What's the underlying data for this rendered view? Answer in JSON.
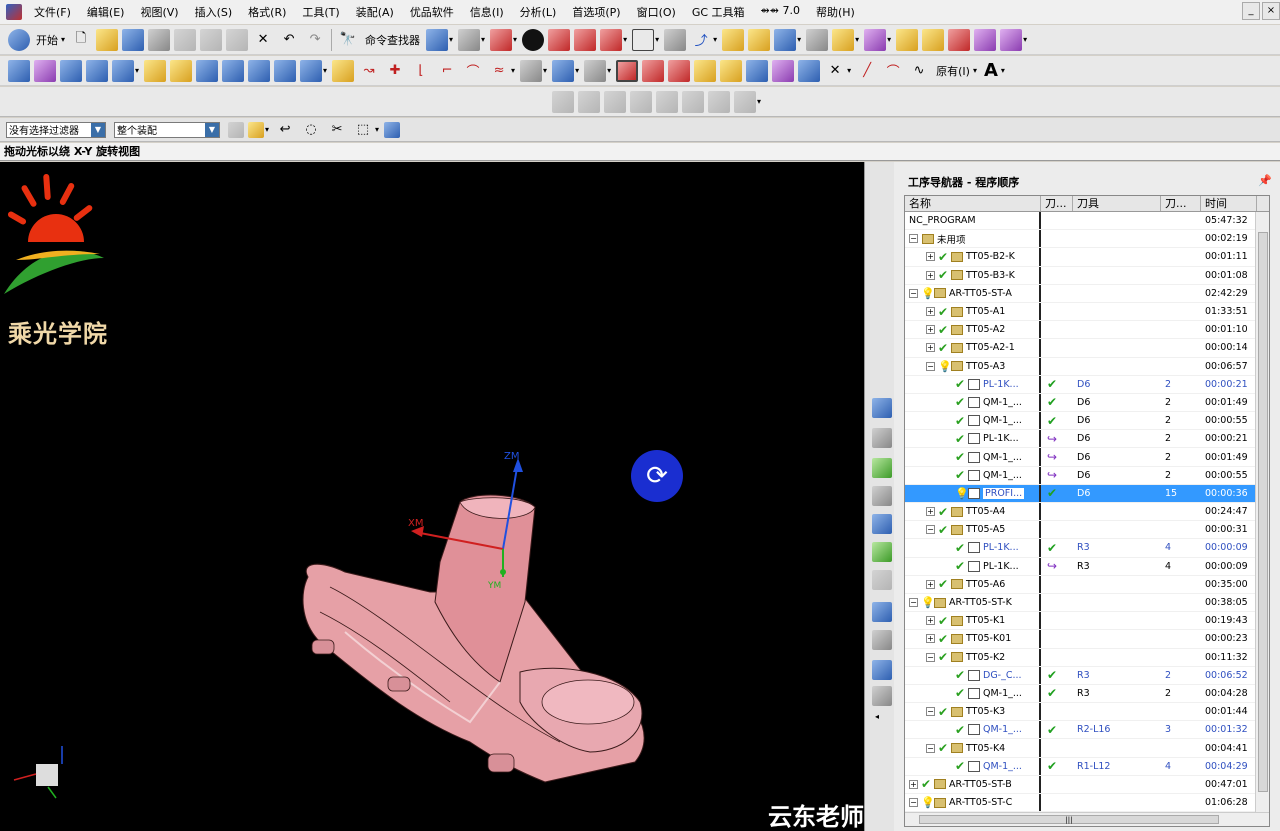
{
  "menubar": {
    "items": [
      "文件(F)",
      "编辑(E)",
      "视图(V)",
      "插入(S)",
      "格式(R)",
      "工具(T)",
      "装配(A)",
      "优品软件",
      "信息(I)",
      "分析(L)",
      "首选项(P)",
      "窗口(O)",
      "GC 工具箱",
      "⇴⇴ 7.0",
      "帮助(H)"
    ]
  },
  "toolbar": {
    "start_label": "开始",
    "command_finder_label": "命令查找器",
    "original_label": "原有(I)",
    "text_tool": "A"
  },
  "filterbar": {
    "selection_filter": "没有选择过滤器",
    "assembly_scope": "整个装配"
  },
  "status": {
    "prompt": "拖动光标以绕 X-Y 旋转视图"
  },
  "viewport": {
    "logo_text": "乘光学院",
    "watermark": "云东老师",
    "axis_labels": {
      "zm": "ZM",
      "xm": "XM",
      "ym": "YM"
    }
  },
  "navigator": {
    "title": "工序导航器 - 程序顺序",
    "columns": [
      "名称",
      "刀...",
      "刀具",
      "刀...",
      "时间"
    ],
    "rows": [
      {
        "name": "NC_PROGRAM",
        "level": 0,
        "exp": "",
        "icon": "none",
        "mark": "",
        "c2": "",
        "tool": "",
        "num": "",
        "time": "05:47:32"
      },
      {
        "name": "未用项",
        "level": 0,
        "exp": "-",
        "icon": "folder",
        "mark": "",
        "c2": "",
        "tool": "",
        "num": "",
        "time": "00:02:19"
      },
      {
        "name": "TT05-B2-K",
        "level": 1,
        "exp": "+",
        "icon": "folder",
        "mark": "check",
        "c2": "",
        "tool": "",
        "num": "",
        "time": "00:01:11"
      },
      {
        "name": "TT05-B3-K",
        "level": 1,
        "exp": "+",
        "icon": "folder",
        "mark": "check",
        "c2": "",
        "tool": "",
        "num": "",
        "time": "00:01:08"
      },
      {
        "name": "AR-TT05-ST-A",
        "level": 0,
        "exp": "-",
        "icon": "folder",
        "mark": "bulb",
        "c2": "",
        "tool": "",
        "num": "",
        "time": "02:42:29"
      },
      {
        "name": "TT05-A1",
        "level": 1,
        "exp": "+",
        "icon": "folder",
        "mark": "check",
        "c2": "",
        "tool": "",
        "num": "",
        "time": "01:33:51"
      },
      {
        "name": "TT05-A2",
        "level": 1,
        "exp": "+",
        "icon": "folder",
        "mark": "check",
        "c2": "",
        "tool": "",
        "num": "",
        "time": "00:01:10"
      },
      {
        "name": "TT05-A2-1",
        "level": 1,
        "exp": "+",
        "icon": "folder",
        "mark": "check",
        "c2": "",
        "tool": "",
        "num": "",
        "time": "00:00:14"
      },
      {
        "name": "TT05-A3",
        "level": 1,
        "exp": "-",
        "icon": "folder",
        "mark": "bulb",
        "c2": "",
        "tool": "",
        "num": "",
        "time": "00:06:57"
      },
      {
        "name": "PL-1K...",
        "level": 2,
        "exp": "",
        "icon": "op",
        "mark": "check",
        "c2": "ok",
        "tool": "D6",
        "num": "2",
        "time": "00:00:21",
        "blue": true
      },
      {
        "name": "QM-1_...",
        "level": 2,
        "exp": "",
        "icon": "op",
        "mark": "check",
        "c2": "ok",
        "tool": "D6",
        "num": "2",
        "time": "00:01:49"
      },
      {
        "name": "QM-1_...",
        "level": 2,
        "exp": "",
        "icon": "op",
        "mark": "check",
        "c2": "ok",
        "tool": "D6",
        "num": "2",
        "time": "00:00:55"
      },
      {
        "name": "PL-1K...",
        "level": 2,
        "exp": "",
        "icon": "op",
        "mark": "check",
        "c2": "re",
        "tool": "D6",
        "num": "2",
        "time": "00:00:21"
      },
      {
        "name": "QM-1_...",
        "level": 2,
        "exp": "",
        "icon": "op",
        "mark": "check",
        "c2": "re",
        "tool": "D6",
        "num": "2",
        "time": "00:01:49"
      },
      {
        "name": "QM-1_...",
        "level": 2,
        "exp": "",
        "icon": "op",
        "mark": "check",
        "c2": "re",
        "tool": "D6",
        "num": "2",
        "time": "00:00:55"
      },
      {
        "name": "PROFI...",
        "level": 2,
        "exp": "",
        "icon": "op",
        "mark": "bulb",
        "c2": "ok",
        "tool": "D6",
        "num": "15",
        "time": "00:00:36",
        "selected": true
      },
      {
        "name": "TT05-A4",
        "level": 1,
        "exp": "+",
        "icon": "folder",
        "mark": "check",
        "c2": "",
        "tool": "",
        "num": "",
        "time": "00:24:47"
      },
      {
        "name": "TT05-A5",
        "level": 1,
        "exp": "-",
        "icon": "folder",
        "mark": "check",
        "c2": "",
        "tool": "",
        "num": "",
        "time": "00:00:31"
      },
      {
        "name": "PL-1K...",
        "level": 2,
        "exp": "",
        "icon": "op",
        "mark": "check",
        "c2": "ok",
        "tool": "R3",
        "num": "4",
        "time": "00:00:09",
        "blue": true
      },
      {
        "name": "PL-1K...",
        "level": 2,
        "exp": "",
        "icon": "op",
        "mark": "check",
        "c2": "re",
        "tool": "R3",
        "num": "4",
        "time": "00:00:09"
      },
      {
        "name": "TT05-A6",
        "level": 1,
        "exp": "+",
        "icon": "folder",
        "mark": "check",
        "c2": "",
        "tool": "",
        "num": "",
        "time": "00:35:00"
      },
      {
        "name": "AR-TT05-ST-K",
        "level": 0,
        "exp": "-",
        "icon": "folder",
        "mark": "bulb",
        "c2": "",
        "tool": "",
        "num": "",
        "time": "00:38:05"
      },
      {
        "name": "TT05-K1",
        "level": 1,
        "exp": "+",
        "icon": "folder",
        "mark": "check",
        "c2": "",
        "tool": "",
        "num": "",
        "time": "00:19:43"
      },
      {
        "name": "TT05-K01",
        "level": 1,
        "exp": "+",
        "icon": "folder",
        "mark": "check",
        "c2": "",
        "tool": "",
        "num": "",
        "time": "00:00:23"
      },
      {
        "name": "TT05-K2",
        "level": 1,
        "exp": "-",
        "icon": "folder",
        "mark": "check",
        "c2": "",
        "tool": "",
        "num": "",
        "time": "00:11:32"
      },
      {
        "name": "DG-_C...",
        "level": 2,
        "exp": "",
        "icon": "op",
        "mark": "check",
        "c2": "ok",
        "tool": "R3",
        "num": "2",
        "time": "00:06:52",
        "blue": true
      },
      {
        "name": "QM-1_...",
        "level": 2,
        "exp": "",
        "icon": "op",
        "mark": "check",
        "c2": "ok",
        "tool": "R3",
        "num": "2",
        "time": "00:04:28"
      },
      {
        "name": "TT05-K3",
        "level": 1,
        "exp": "-",
        "icon": "folder",
        "mark": "check",
        "c2": "",
        "tool": "",
        "num": "",
        "time": "00:01:44"
      },
      {
        "name": "QM-1_...",
        "level": 2,
        "exp": "",
        "icon": "op",
        "mark": "check",
        "c2": "ok",
        "tool": "R2-L16",
        "num": "3",
        "time": "00:01:32",
        "blue": true
      },
      {
        "name": "TT05-K4",
        "level": 1,
        "exp": "-",
        "icon": "folder",
        "mark": "check",
        "c2": "",
        "tool": "",
        "num": "",
        "time": "00:04:41"
      },
      {
        "name": "QM-1_...",
        "level": 2,
        "exp": "",
        "icon": "op",
        "mark": "check",
        "c2": "ok",
        "tool": "R1-L12",
        "num": "4",
        "time": "00:04:29",
        "blue": true
      },
      {
        "name": "AR-TT05-ST-B",
        "level": 0,
        "exp": "+",
        "icon": "folder",
        "mark": "check",
        "c2": "",
        "tool": "",
        "num": "",
        "time": "00:47:01"
      },
      {
        "name": "AR-TT05-ST-C",
        "level": 0,
        "exp": "-",
        "icon": "folder",
        "mark": "bulb",
        "c2": "",
        "tool": "",
        "num": "",
        "time": "01:06:28"
      }
    ]
  },
  "colors": {
    "selection": "#3399ff",
    "viewport_bg": "#000000",
    "part": "#e8a0a0",
    "rotate_button": "#1a2ed0"
  }
}
